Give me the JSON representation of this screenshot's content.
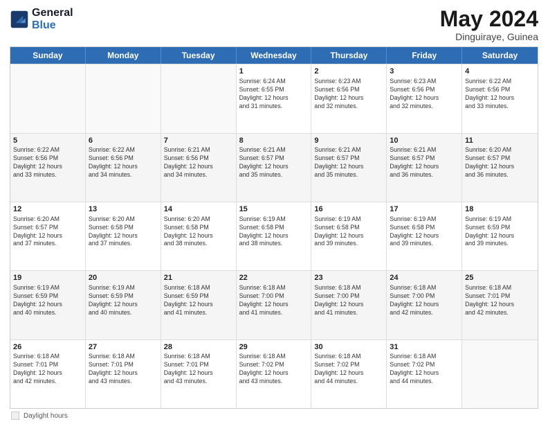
{
  "header": {
    "logo_line1": "General",
    "logo_line2": "Blue",
    "month_title": "May 2024",
    "location": "Dinguiraye, Guinea"
  },
  "footer": {
    "legend_label": "Daylight hours"
  },
  "weekdays": [
    "Sunday",
    "Monday",
    "Tuesday",
    "Wednesday",
    "Thursday",
    "Friday",
    "Saturday"
  ],
  "weeks": [
    [
      {
        "day": "",
        "info": "",
        "empty": true
      },
      {
        "day": "",
        "info": "",
        "empty": true
      },
      {
        "day": "",
        "info": "",
        "empty": true
      },
      {
        "day": "1",
        "info": "Sunrise: 6:24 AM\nSunset: 6:55 PM\nDaylight: 12 hours\nand 31 minutes."
      },
      {
        "day": "2",
        "info": "Sunrise: 6:23 AM\nSunset: 6:56 PM\nDaylight: 12 hours\nand 32 minutes."
      },
      {
        "day": "3",
        "info": "Sunrise: 6:23 AM\nSunset: 6:56 PM\nDaylight: 12 hours\nand 32 minutes."
      },
      {
        "day": "4",
        "info": "Sunrise: 6:22 AM\nSunset: 6:56 PM\nDaylight: 12 hours\nand 33 minutes."
      }
    ],
    [
      {
        "day": "5",
        "info": "Sunrise: 6:22 AM\nSunset: 6:56 PM\nDaylight: 12 hours\nand 33 minutes."
      },
      {
        "day": "6",
        "info": "Sunrise: 6:22 AM\nSunset: 6:56 PM\nDaylight: 12 hours\nand 34 minutes."
      },
      {
        "day": "7",
        "info": "Sunrise: 6:21 AM\nSunset: 6:56 PM\nDaylight: 12 hours\nand 34 minutes."
      },
      {
        "day": "8",
        "info": "Sunrise: 6:21 AM\nSunset: 6:57 PM\nDaylight: 12 hours\nand 35 minutes."
      },
      {
        "day": "9",
        "info": "Sunrise: 6:21 AM\nSunset: 6:57 PM\nDaylight: 12 hours\nand 35 minutes."
      },
      {
        "day": "10",
        "info": "Sunrise: 6:21 AM\nSunset: 6:57 PM\nDaylight: 12 hours\nand 36 minutes."
      },
      {
        "day": "11",
        "info": "Sunrise: 6:20 AM\nSunset: 6:57 PM\nDaylight: 12 hours\nand 36 minutes."
      }
    ],
    [
      {
        "day": "12",
        "info": "Sunrise: 6:20 AM\nSunset: 6:57 PM\nDaylight: 12 hours\nand 37 minutes."
      },
      {
        "day": "13",
        "info": "Sunrise: 6:20 AM\nSunset: 6:58 PM\nDaylight: 12 hours\nand 37 minutes."
      },
      {
        "day": "14",
        "info": "Sunrise: 6:20 AM\nSunset: 6:58 PM\nDaylight: 12 hours\nand 38 minutes."
      },
      {
        "day": "15",
        "info": "Sunrise: 6:19 AM\nSunset: 6:58 PM\nDaylight: 12 hours\nand 38 minutes."
      },
      {
        "day": "16",
        "info": "Sunrise: 6:19 AM\nSunset: 6:58 PM\nDaylight: 12 hours\nand 39 minutes."
      },
      {
        "day": "17",
        "info": "Sunrise: 6:19 AM\nSunset: 6:58 PM\nDaylight: 12 hours\nand 39 minutes."
      },
      {
        "day": "18",
        "info": "Sunrise: 6:19 AM\nSunset: 6:59 PM\nDaylight: 12 hours\nand 39 minutes."
      }
    ],
    [
      {
        "day": "19",
        "info": "Sunrise: 6:19 AM\nSunset: 6:59 PM\nDaylight: 12 hours\nand 40 minutes."
      },
      {
        "day": "20",
        "info": "Sunrise: 6:19 AM\nSunset: 6:59 PM\nDaylight: 12 hours\nand 40 minutes."
      },
      {
        "day": "21",
        "info": "Sunrise: 6:18 AM\nSunset: 6:59 PM\nDaylight: 12 hours\nand 41 minutes."
      },
      {
        "day": "22",
        "info": "Sunrise: 6:18 AM\nSunset: 7:00 PM\nDaylight: 12 hours\nand 41 minutes."
      },
      {
        "day": "23",
        "info": "Sunrise: 6:18 AM\nSunset: 7:00 PM\nDaylight: 12 hours\nand 41 minutes."
      },
      {
        "day": "24",
        "info": "Sunrise: 6:18 AM\nSunset: 7:00 PM\nDaylight: 12 hours\nand 42 minutes."
      },
      {
        "day": "25",
        "info": "Sunrise: 6:18 AM\nSunset: 7:01 PM\nDaylight: 12 hours\nand 42 minutes."
      }
    ],
    [
      {
        "day": "26",
        "info": "Sunrise: 6:18 AM\nSunset: 7:01 PM\nDaylight: 12 hours\nand 42 minutes."
      },
      {
        "day": "27",
        "info": "Sunrise: 6:18 AM\nSunset: 7:01 PM\nDaylight: 12 hours\nand 43 minutes."
      },
      {
        "day": "28",
        "info": "Sunrise: 6:18 AM\nSunset: 7:01 PM\nDaylight: 12 hours\nand 43 minutes."
      },
      {
        "day": "29",
        "info": "Sunrise: 6:18 AM\nSunset: 7:02 PM\nDaylight: 12 hours\nand 43 minutes."
      },
      {
        "day": "30",
        "info": "Sunrise: 6:18 AM\nSunset: 7:02 PM\nDaylight: 12 hours\nand 44 minutes."
      },
      {
        "day": "31",
        "info": "Sunrise: 6:18 AM\nSunset: 7:02 PM\nDaylight: 12 hours\nand 44 minutes."
      },
      {
        "day": "",
        "info": "",
        "empty": true
      }
    ]
  ]
}
